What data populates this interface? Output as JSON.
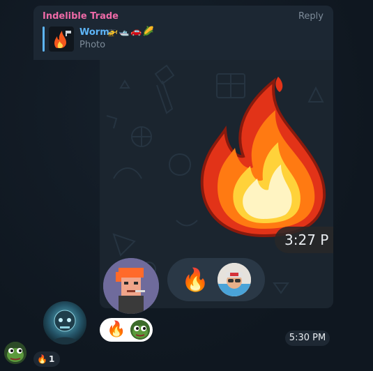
{
  "message": {
    "sender": "Indelible Trade",
    "reply_label": "Reply",
    "quote": {
      "name": "Worm",
      "emojis": "🚁🛥️🚗🌽",
      "subtitle": "Photo"
    },
    "sticker_time": "3:27 P",
    "reactions": {
      "emoji": "🔥"
    }
  },
  "bottom_reactions": {
    "emoji": "🔥"
  },
  "time": "5:30 PM",
  "next_message": {
    "reaction_emoji": "🔥",
    "reaction_count": "1"
  },
  "colors": {
    "accent_sender": "#ee6aa7",
    "accent_quote": "#5eb5f7",
    "bubble": "#1c2733",
    "background": "#0f1720"
  }
}
